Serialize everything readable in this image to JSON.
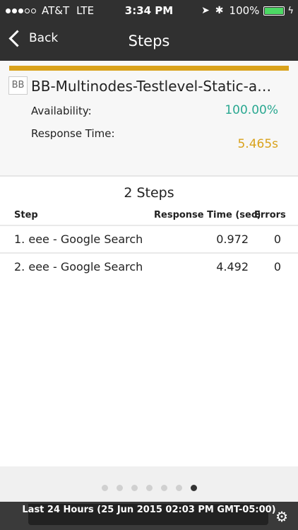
{
  "status_bar": {
    "carrier": "AT&T",
    "network": "LTE",
    "time": "3:34 PM",
    "battery": "100%",
    "battery_level": 1.0,
    "signal_bars": 3,
    "signal_total": 5
  },
  "nav": {
    "back_label": "Back",
    "title": "Steps"
  },
  "monitor": {
    "icon_text": "BB",
    "name": "BB-Multinodes-Testlevel-Static-a…",
    "availability_label": "Availability:",
    "availability_value": "100.00%",
    "response_time_label": "Response Time:",
    "response_time_value": "5.465s",
    "colors": {
      "bar": "#d9a21b",
      "availability": "#2aa891",
      "response": "#d9a21b"
    }
  },
  "steps": {
    "title": "2 Steps",
    "columns": {
      "step": "Step",
      "response_time": "Response Time (sec)",
      "errors": "Errors"
    },
    "rows": [
      {
        "name": "1.  eee - Google Search",
        "response_time": "0.972",
        "errors": "0"
      },
      {
        "name": "2. eee - Google Search",
        "response_time": "4.492",
        "errors": "0"
      }
    ]
  },
  "pager": {
    "total": 7,
    "active_index": 6
  },
  "footer": {
    "range_text": "Last 24 Hours (25 Jun 2015 02:03 PM GMT-05:00)",
    "icon": "gear-icon"
  }
}
